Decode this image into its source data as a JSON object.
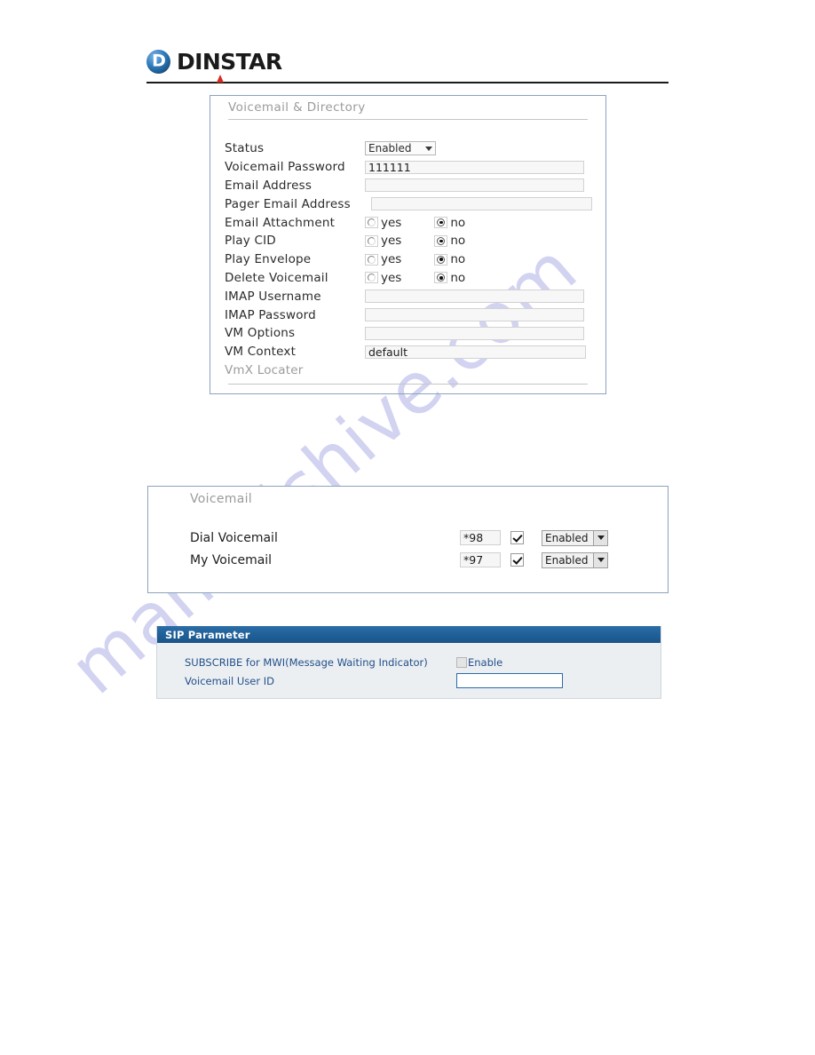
{
  "header": {
    "logo_text": "DINSTAR",
    "logo_icon": "dinstar-globe-d-icon"
  },
  "watermark": {
    "text": "manualshive.com"
  },
  "panel_voicemail_directory": {
    "title": "Voicemail & Directory",
    "rows": [
      {
        "label": "Status",
        "type": "select",
        "value": "Enabled"
      },
      {
        "label": "Voicemail Password",
        "type": "text",
        "value": "111111"
      },
      {
        "label": "Email Address",
        "type": "text",
        "value": ""
      },
      {
        "label": "Pager Email Address",
        "type": "text",
        "value": ""
      },
      {
        "label": "Email Attachment",
        "type": "radio",
        "yes_label": "yes",
        "no_label": "no",
        "selected": "no"
      },
      {
        "label": "Play CID",
        "type": "radio",
        "yes_label": "yes",
        "no_label": "no",
        "selected": "no"
      },
      {
        "label": "Play Envelope",
        "type": "radio",
        "yes_label": "yes",
        "no_label": "no",
        "selected": "no"
      },
      {
        "label": "Delete Voicemail",
        "type": "radio",
        "yes_label": "yes",
        "no_label": "no",
        "selected": "no"
      },
      {
        "label": "IMAP Username",
        "type": "text",
        "value": ""
      },
      {
        "label": "IMAP Password",
        "type": "text",
        "value": ""
      },
      {
        "label": "VM Options",
        "type": "text",
        "value": ""
      },
      {
        "label": "VM Context",
        "type": "text",
        "value": "default"
      },
      {
        "label": "VmX Locater",
        "type": "none",
        "value": ""
      }
    ]
  },
  "panel_voicemail": {
    "title": "Voicemail",
    "rows": [
      {
        "label": "Dial Voicemail",
        "code": "*98",
        "checked": true,
        "status": "Enabled"
      },
      {
        "label": "My Voicemail",
        "code": "*97",
        "checked": true,
        "status": "Enabled"
      }
    ]
  },
  "panel_sip_parameter": {
    "title": "SIP Parameter",
    "subscribe_label": "SUBSCRIBE for MWI(Message Waiting Indicator)",
    "enable_label": "Enable",
    "enable_checked": false,
    "userid_label": "Voicemail User ID",
    "userid_value": ""
  },
  "colors": {
    "sip_header_blue": "#1f5e97",
    "sip_label_blue": "#21508c",
    "panel_border": "#8ba3bd",
    "watermark": "#c9c9ef",
    "logo_accent_red": "#d42a20"
  }
}
